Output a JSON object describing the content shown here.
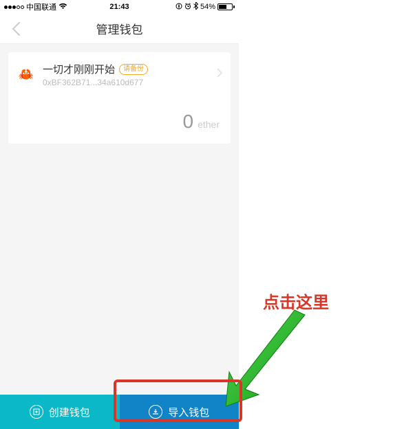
{
  "status_bar": {
    "carrier": "中国联通",
    "time": "21:43",
    "battery_pct": "54%"
  },
  "nav": {
    "title": "管理钱包"
  },
  "wallet": {
    "icon_emoji": "🦀",
    "name": "一切才刚刚开始",
    "backup_badge": "请备份",
    "address": "0xBF362B71...34a610d677",
    "balance_value": "0",
    "balance_unit": "ether"
  },
  "bottom": {
    "create_label": "创建钱包",
    "import_label": "导入钱包"
  },
  "annotation": {
    "text": "点击这里"
  }
}
